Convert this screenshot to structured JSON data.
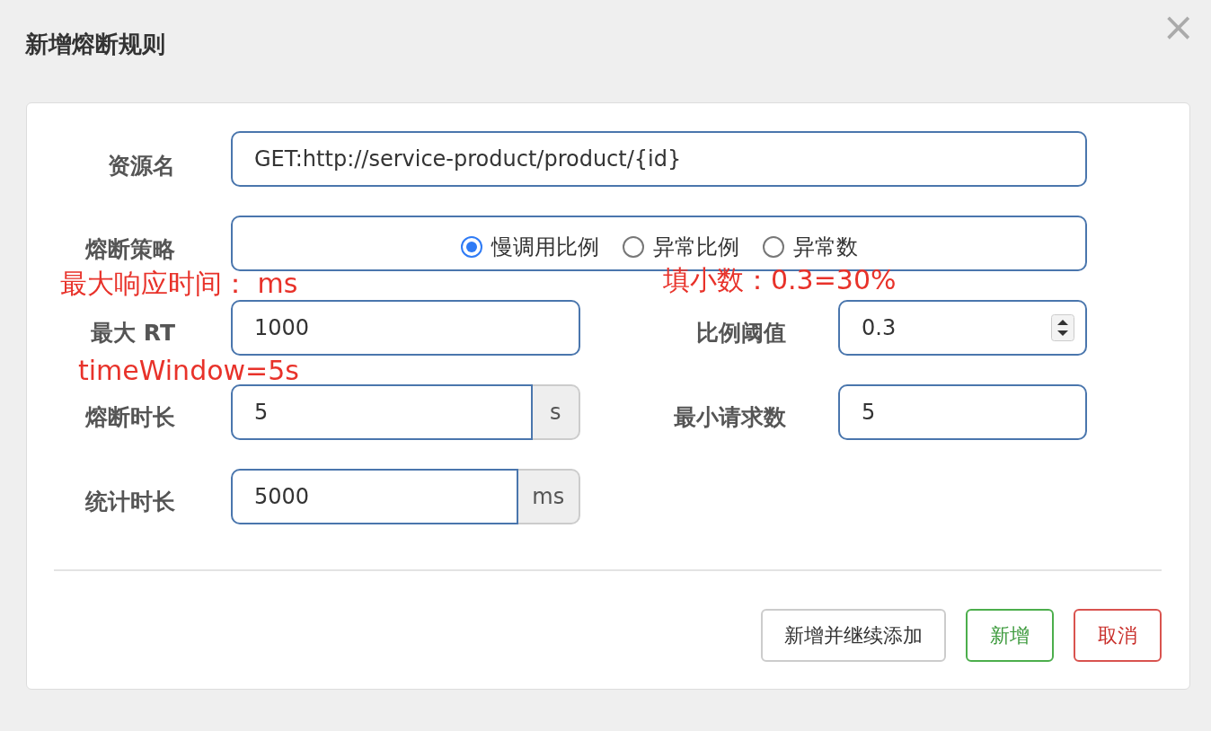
{
  "dialog": {
    "title": "新增熔断规则",
    "close": "×"
  },
  "resource": {
    "label": "资源名",
    "value": "GET:http://service-product/product/{id}"
  },
  "strategy": {
    "label": "熔断策略",
    "options": [
      {
        "label": "慢调用比例",
        "selected": true
      },
      {
        "label": "异常比例",
        "selected": false
      },
      {
        "label": "异常数",
        "selected": false
      }
    ]
  },
  "fields": [
    {
      "label": "最大 RT",
      "value": "1000",
      "kind": "plain"
    },
    {
      "label": "比例阈值",
      "value": "0.3",
      "kind": "number"
    },
    {
      "label": "熔断时长",
      "value": "5",
      "kind": "unit",
      "unit": "s"
    },
    {
      "label": "最小请求数",
      "value": "5",
      "kind": "plain"
    },
    {
      "label": "统计时长",
      "value": "5000",
      "kind": "unit",
      "unit": "ms"
    }
  ],
  "annotations": [
    {
      "text": "最大响应时间： ms"
    },
    {
      "text": "填小数：0.3=30%"
    },
    {
      "text": "timeWindow=5s"
    }
  ],
  "buttons": [
    {
      "label": "新增并继续添加",
      "kind": "default"
    },
    {
      "label": "新增",
      "kind": "success"
    },
    {
      "label": "取消",
      "kind": "danger"
    }
  ]
}
